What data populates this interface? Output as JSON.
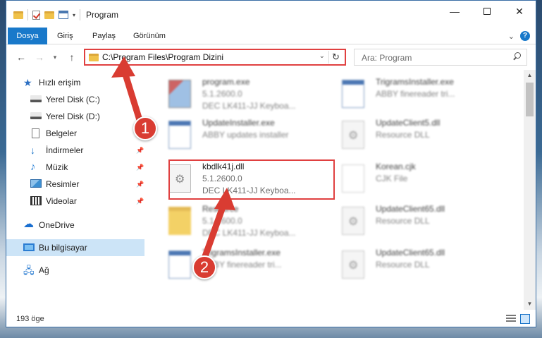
{
  "window": {
    "title": "Program",
    "controls": {
      "minimize": "—",
      "restore": "☐",
      "close": "✕"
    }
  },
  "ribbon": {
    "tabs": [
      "Dosya",
      "Giriş",
      "Paylaş",
      "Görünüm"
    ]
  },
  "address": {
    "path": "C:\\Program Files\\Program Dizini",
    "refresh": "↻"
  },
  "search": {
    "placeholder": "Ara: Program"
  },
  "sidebar": {
    "items": [
      {
        "label": "Hızlı erişim",
        "icon": "star-icon"
      },
      {
        "label": "Yerel Disk (C:)",
        "icon": "drive-icon"
      },
      {
        "label": "Yerel Disk (D:)",
        "icon": "drive-icon"
      },
      {
        "label": "Belgeler",
        "icon": "documents-icon"
      },
      {
        "label": "İndirmeler",
        "icon": "downloads-icon"
      },
      {
        "label": "Müzik",
        "icon": "music-icon"
      },
      {
        "label": "Resimler",
        "icon": "pictures-icon"
      },
      {
        "label": "Videolar",
        "icon": "videos-icon"
      },
      {
        "label": "OneDrive",
        "icon": "cloud-icon"
      },
      {
        "label": "Bu bilgisayar",
        "icon": "computer-icon"
      },
      {
        "label": "Ağ",
        "icon": "network-icon"
      }
    ]
  },
  "files": [
    {
      "name": "program.exe",
      "line1": "5.1.2600.0",
      "line2": "DEC LK411-JJ Keyboa..."
    },
    {
      "name": "TrigramsInstaller.exe",
      "line1": "ABBY finereader tri...",
      "line2": ""
    },
    {
      "name": "UpdateInstaller.exe",
      "line1": "ABBY updates installer",
      "line2": ""
    },
    {
      "name": "UpdateClient5.dll",
      "line1": "Resource DLL",
      "line2": ""
    },
    {
      "name": "kbdlk41j.dll",
      "line1": "5.1.2600.0",
      "line2": "DEC LK411-JJ Keyboa..."
    },
    {
      "name": "Korean.cjk",
      "line1": "CJK File",
      "line2": ""
    },
    {
      "name": "Resource",
      "line1": "5.1.2600.0",
      "line2": "DEC LK411-JJ Keyboa..."
    },
    {
      "name": "UpdateClient65.dll",
      "line1": "Resource DLL",
      "line2": ""
    },
    {
      "name": "TrigramsInstaller.exe",
      "line1": "ABBY finereader tri...",
      "line2": ""
    },
    {
      "name": "UpdateClient65.dll",
      "line1": "Resource DLL",
      "line2": ""
    }
  ],
  "status": {
    "count": "193 öge"
  },
  "annotations": {
    "step1": "1",
    "step2": "2",
    "color": "#d93c32"
  }
}
